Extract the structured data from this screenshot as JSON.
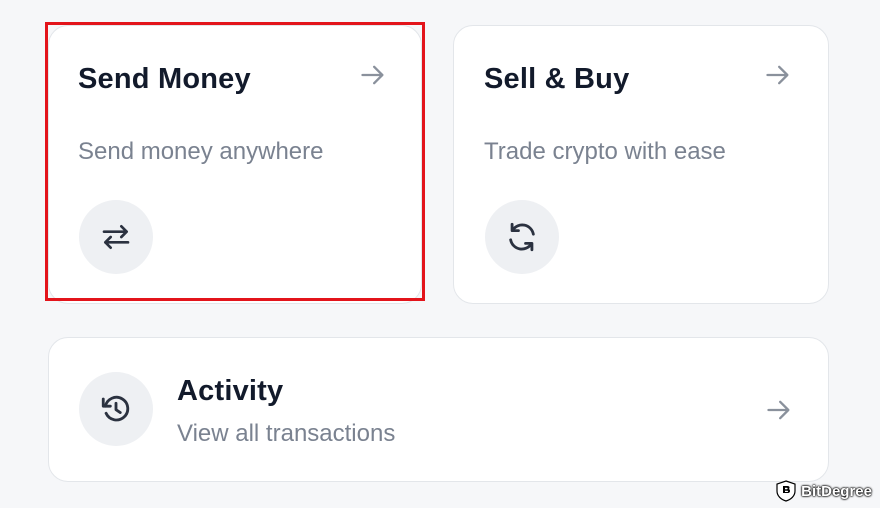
{
  "send_money": {
    "title": "Send Money",
    "subtitle": "Send money anywhere",
    "icon": "swap-arrows-icon"
  },
  "sell_buy": {
    "title": "Sell & Buy",
    "subtitle": "Trade crypto with ease",
    "icon": "refresh-icon"
  },
  "activity": {
    "title": "Activity",
    "subtitle": "View all transactions",
    "icon": "history-icon"
  },
  "watermark": {
    "text": "BitDegree"
  },
  "colors": {
    "highlight": "#e3141b",
    "title": "#121a2b",
    "subtitle": "#7a8290",
    "icon_bg": "#eef0f3"
  }
}
